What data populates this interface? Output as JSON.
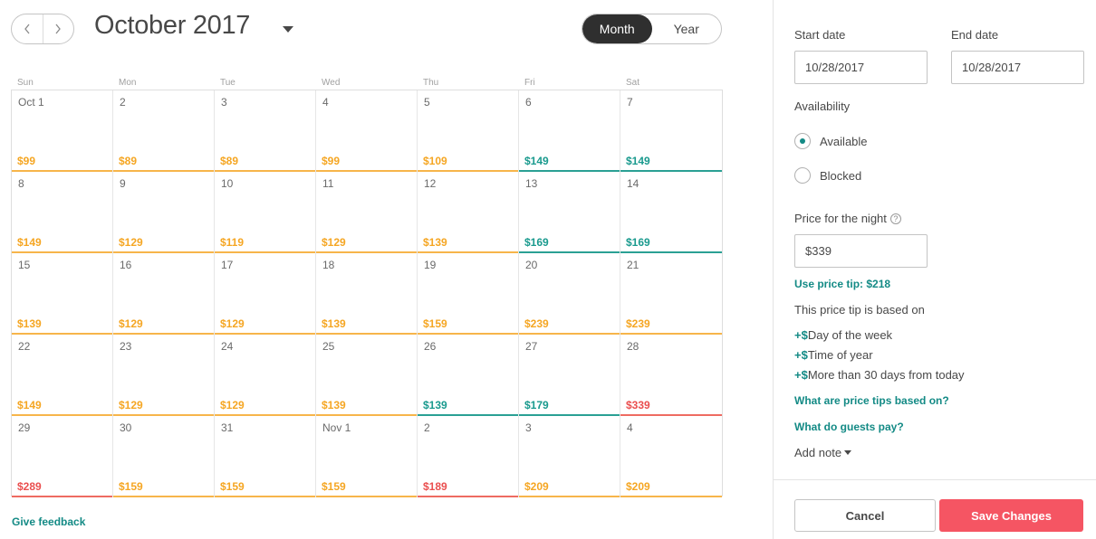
{
  "calendar": {
    "title": "October 2017",
    "view_options": [
      "Month",
      "Year"
    ],
    "active_view": "Month",
    "weekdays": [
      "Sun",
      "Mon",
      "Tue",
      "Wed",
      "Thu",
      "Fri",
      "Sat"
    ],
    "weeks": [
      [
        {
          "day": "Oct 1",
          "price": "$99",
          "tier": "orange"
        },
        {
          "day": "2",
          "price": "$89",
          "tier": "orange"
        },
        {
          "day": "3",
          "price": "$89",
          "tier": "orange"
        },
        {
          "day": "4",
          "price": "$99",
          "tier": "orange"
        },
        {
          "day": "5",
          "price": "$109",
          "tier": "orange"
        },
        {
          "day": "6",
          "price": "$149",
          "tier": "teal"
        },
        {
          "day": "7",
          "price": "$149",
          "tier": "teal"
        }
      ],
      [
        {
          "day": "8",
          "price": "$149",
          "tier": "orange"
        },
        {
          "day": "9",
          "price": "$129",
          "tier": "orange"
        },
        {
          "day": "10",
          "price": "$119",
          "tier": "orange"
        },
        {
          "day": "11",
          "price": "$129",
          "tier": "orange"
        },
        {
          "day": "12",
          "price": "$139",
          "tier": "orange"
        },
        {
          "day": "13",
          "price": "$169",
          "tier": "teal"
        },
        {
          "day": "14",
          "price": "$169",
          "tier": "teal"
        }
      ],
      [
        {
          "day": "15",
          "price": "$139",
          "tier": "orange"
        },
        {
          "day": "16",
          "price": "$129",
          "tier": "orange"
        },
        {
          "day": "17",
          "price": "$129",
          "tier": "orange"
        },
        {
          "day": "18",
          "price": "$139",
          "tier": "orange"
        },
        {
          "day": "19",
          "price": "$159",
          "tier": "orange"
        },
        {
          "day": "20",
          "price": "$239",
          "tier": "orange"
        },
        {
          "day": "21",
          "price": "$239",
          "tier": "orange"
        }
      ],
      [
        {
          "day": "22",
          "price": "$149",
          "tier": "orange"
        },
        {
          "day": "23",
          "price": "$129",
          "tier": "orange"
        },
        {
          "day": "24",
          "price": "$129",
          "tier": "orange"
        },
        {
          "day": "25",
          "price": "$139",
          "tier": "orange"
        },
        {
          "day": "26",
          "price": "$139",
          "tier": "teal"
        },
        {
          "day": "27",
          "price": "$179",
          "tier": "teal"
        },
        {
          "day": "28",
          "price": "$339",
          "tier": "red"
        }
      ],
      [
        {
          "day": "29",
          "price": "$289",
          "tier": "red"
        },
        {
          "day": "30",
          "price": "$159",
          "tier": "orange"
        },
        {
          "day": "31",
          "price": "$159",
          "tier": "orange"
        },
        {
          "day": "Nov 1",
          "price": "$159",
          "tier": "orange"
        },
        {
          "day": "2",
          "price": "$189",
          "tier": "red"
        },
        {
          "day": "3",
          "price": "$209",
          "tier": "orange"
        },
        {
          "day": "4",
          "price": "$209",
          "tier": "orange"
        }
      ]
    ],
    "feedback_link": "Give feedback"
  },
  "colors": {
    "orange": "#f5a623",
    "teal": "#1a9a8e",
    "red": "#ea4f4f",
    "accent_link": "#138a85",
    "save_button": "#f55563"
  },
  "icons": {
    "prev": "chevron-left-icon",
    "next": "chevron-right-icon",
    "month_dropdown": "caret-down-icon",
    "help": "question-circle-icon"
  },
  "panel": {
    "start_date_label": "Start date",
    "start_date_value": "10/28/2017",
    "end_date_label": "End date",
    "end_date_value": "10/28/2017",
    "availability_label": "Availability",
    "availability_options": [
      "Available",
      "Blocked"
    ],
    "availability_selected": "Available",
    "price_label": "Price for the night",
    "price_value": "$339",
    "price_tip_link": "Use price tip: $218",
    "tip_basis_text": "This price tip is based on",
    "tip_plus": "+$",
    "tip_reasons": [
      "Day of the week",
      "Time of year",
      "More than 30 days from today"
    ],
    "tips_info_link": "What are price tips based on?",
    "guests_pay_link": "What do guests pay?",
    "add_note_label": "Add note",
    "cancel_label": "Cancel",
    "save_label": "Save Changes"
  }
}
